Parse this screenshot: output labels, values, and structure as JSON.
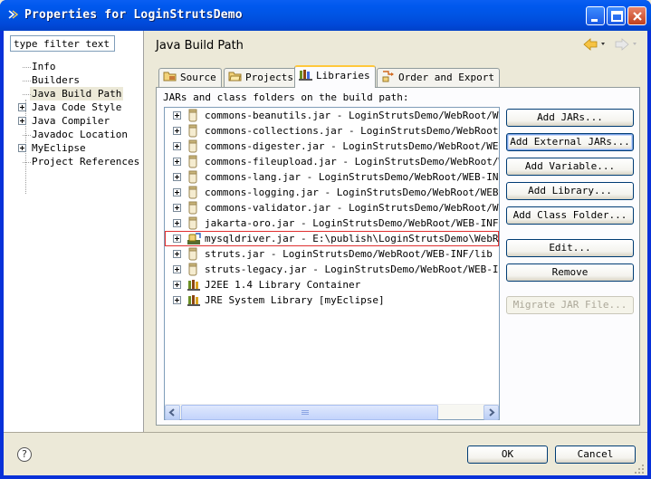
{
  "window": {
    "title": "Properties for LoginStrutsDemo"
  },
  "left_panel": {
    "filter_value": "type filter text",
    "items": [
      {
        "label": "Info",
        "expandable": false,
        "selected": false
      },
      {
        "label": "Builders",
        "expandable": false,
        "selected": false
      },
      {
        "label": "Java Build Path",
        "expandable": false,
        "selected": true
      },
      {
        "label": "Java Code Style",
        "expandable": true,
        "selected": false
      },
      {
        "label": "Java Compiler",
        "expandable": true,
        "selected": false
      },
      {
        "label": "Javadoc Location",
        "expandable": false,
        "selected": false
      },
      {
        "label": "MyEclipse",
        "expandable": true,
        "selected": false
      },
      {
        "label": "Project References",
        "expandable": false,
        "selected": false
      }
    ]
  },
  "header": {
    "title": "Java Build Path"
  },
  "tabs": [
    {
      "label": "Source",
      "icon": "source-folder-icon"
    },
    {
      "label": "Projects",
      "icon": "projects-folder-icon"
    },
    {
      "label": "Libraries",
      "icon": "libraries-icon",
      "active": true
    },
    {
      "label": "Order and Export",
      "icon": "order-export-icon"
    }
  ],
  "libraries": {
    "list_label": "JARs and class folders on the build path:",
    "entries": [
      {
        "text": "commons-beanutils.jar - LoginStrutsDemo/WebRoot/WEB-INF/lib",
        "icon": "jar-icon"
      },
      {
        "text": "commons-collections.jar - LoginStrutsDemo/WebRoot/WEB-INF/lib",
        "icon": "jar-icon"
      },
      {
        "text": "commons-digester.jar - LoginStrutsDemo/WebRoot/WEB-INF/lib",
        "icon": "jar-icon"
      },
      {
        "text": "commons-fileupload.jar - LoginStrutsDemo/WebRoot/WEB-INF/lib",
        "icon": "jar-icon"
      },
      {
        "text": "commons-lang.jar - LoginStrutsDemo/WebRoot/WEB-INF/lib",
        "icon": "jar-icon"
      },
      {
        "text": "commons-logging.jar - LoginStrutsDemo/WebRoot/WEB-INF/lib",
        "icon": "jar-icon"
      },
      {
        "text": "commons-validator.jar - LoginStrutsDemo/WebRoot/WEB-INF/lib",
        "icon": "jar-icon"
      },
      {
        "text": "jakarta-oro.jar - LoginStrutsDemo/WebRoot/WEB-INF/lib",
        "icon": "jar-icon"
      },
      {
        "text": "mysqldriver.jar - E:\\publish\\LoginStrutsDemo\\WebRoot\\WEB-INF\\lib",
        "icon": "external-jar-icon",
        "highlighted": true
      },
      {
        "text": "struts.jar - LoginStrutsDemo/WebRoot/WEB-INF/lib",
        "icon": "jar-icon"
      },
      {
        "text": "struts-legacy.jar - LoginStrutsDemo/WebRoot/WEB-INF/lib",
        "icon": "jar-icon"
      },
      {
        "text": "J2EE 1.4 Library Container",
        "icon": "library-container-icon"
      },
      {
        "text": "JRE System Library [myEclipse]",
        "icon": "library-container-icon"
      }
    ]
  },
  "side_buttons": {
    "add_jars": "Add JARs...",
    "add_external_jars": "Add External JARs...",
    "add_variable": "Add Variable...",
    "add_library": "Add Library...",
    "add_class_folder": "Add Class Folder...",
    "edit": "Edit...",
    "remove": "Remove",
    "migrate_jar": "Migrate JAR File..."
  },
  "footer": {
    "help_glyph": "?",
    "ok": "OK",
    "cancel": "Cancel"
  },
  "colors": {
    "titlebar": "#0054e3",
    "tab_accent": "#ffc83c",
    "highlight_border": "#e03030"
  }
}
